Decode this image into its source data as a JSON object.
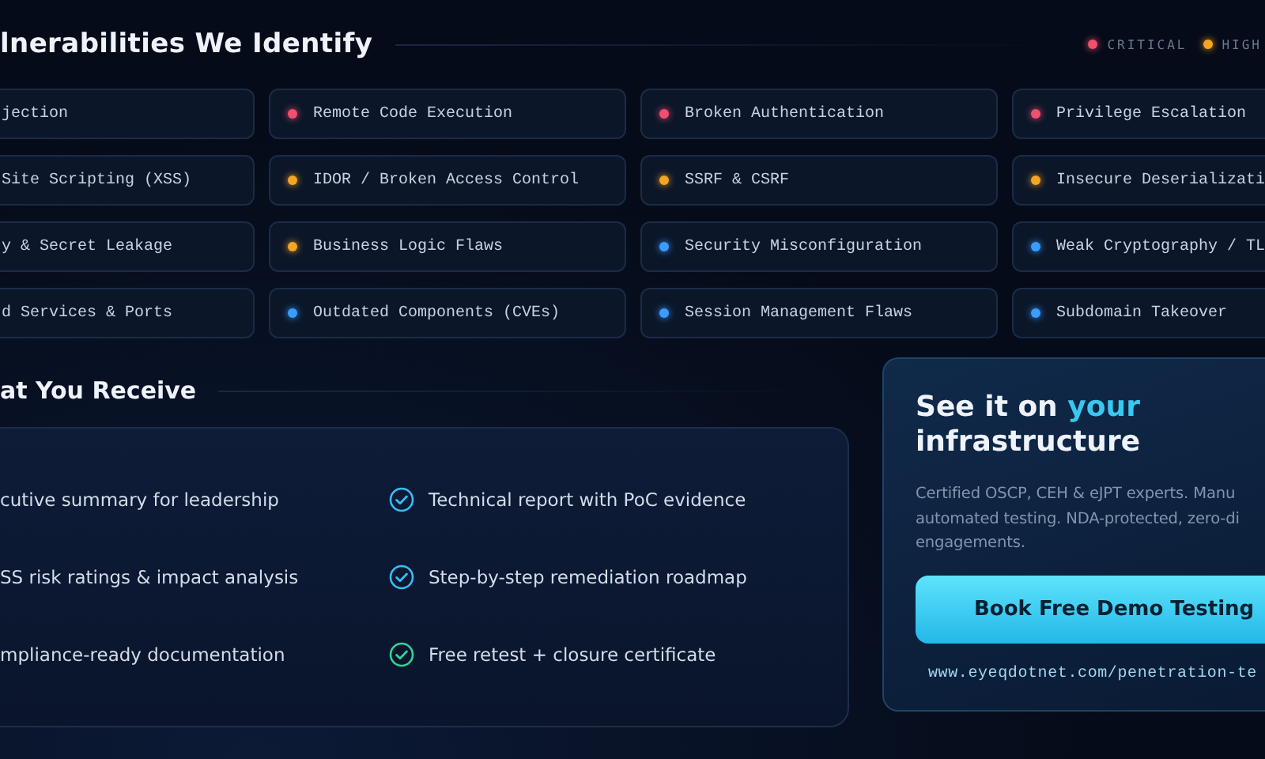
{
  "vulnerabilities": {
    "title": "lnerabilities We Identify",
    "legend": [
      {
        "label": "CRITICAL",
        "color": "#f0506e"
      },
      {
        "label": "HIGH",
        "color": "#f5a524"
      }
    ],
    "items": [
      {
        "label": "jection"
      },
      {
        "label": "Remote Code Execution",
        "color": "#f0506e"
      },
      {
        "label": "Broken Authentication",
        "color": "#f0506e"
      },
      {
        "label": "Privilege Escalation",
        "color": "#f0506e"
      },
      {
        "label": "Site Scripting (XSS)"
      },
      {
        "label": "IDOR / Broken Access Control",
        "color": "#f5a524"
      },
      {
        "label": "SSRF & CSRF",
        "color": "#f5a524"
      },
      {
        "label": "Insecure Deserializati",
        "color": "#f5a524"
      },
      {
        "label": "y & Secret Leakage"
      },
      {
        "label": "Business Logic Flaws",
        "color": "#f5a524"
      },
      {
        "label": "Security Misconfiguration",
        "color": "#3b9cff"
      },
      {
        "label": "Weak Cryptography / TL",
        "color": "#3b9cff"
      },
      {
        "label": "d Services & Ports"
      },
      {
        "label": "Outdated Components (CVEs)",
        "color": "#3b9cff"
      },
      {
        "label": "Session Management Flaws",
        "color": "#3b9cff"
      },
      {
        "label": "Subdomain Takeover",
        "color": "#3b9cff"
      }
    ]
  },
  "deliverables": {
    "title": "at You Receive",
    "items": [
      {
        "label": "cutive summary for leadership"
      },
      {
        "label": "Technical report with PoC evidence",
        "color": "#38bdf8"
      },
      {
        "label": "SS risk ratings & impact analysis"
      },
      {
        "label": "Step-by-step remediation roadmap",
        "color": "#38bdf8"
      },
      {
        "label": "mpliance-ready documentation"
      },
      {
        "label": "Free retest + closure certificate",
        "color": "#34d399"
      }
    ]
  },
  "cta": {
    "title_start": "See it on",
    "title_highlight": "your",
    "title_end": "infrastructure",
    "description_lines": [
      "Certified OSCP, CEH & eJPT experts. Manu",
      "automated testing. NDA-protected, zero-di",
      "engagements."
    ],
    "button": "Book Free Demo Testing",
    "url": "www.eyeqdotnet.com/penetration-te"
  }
}
